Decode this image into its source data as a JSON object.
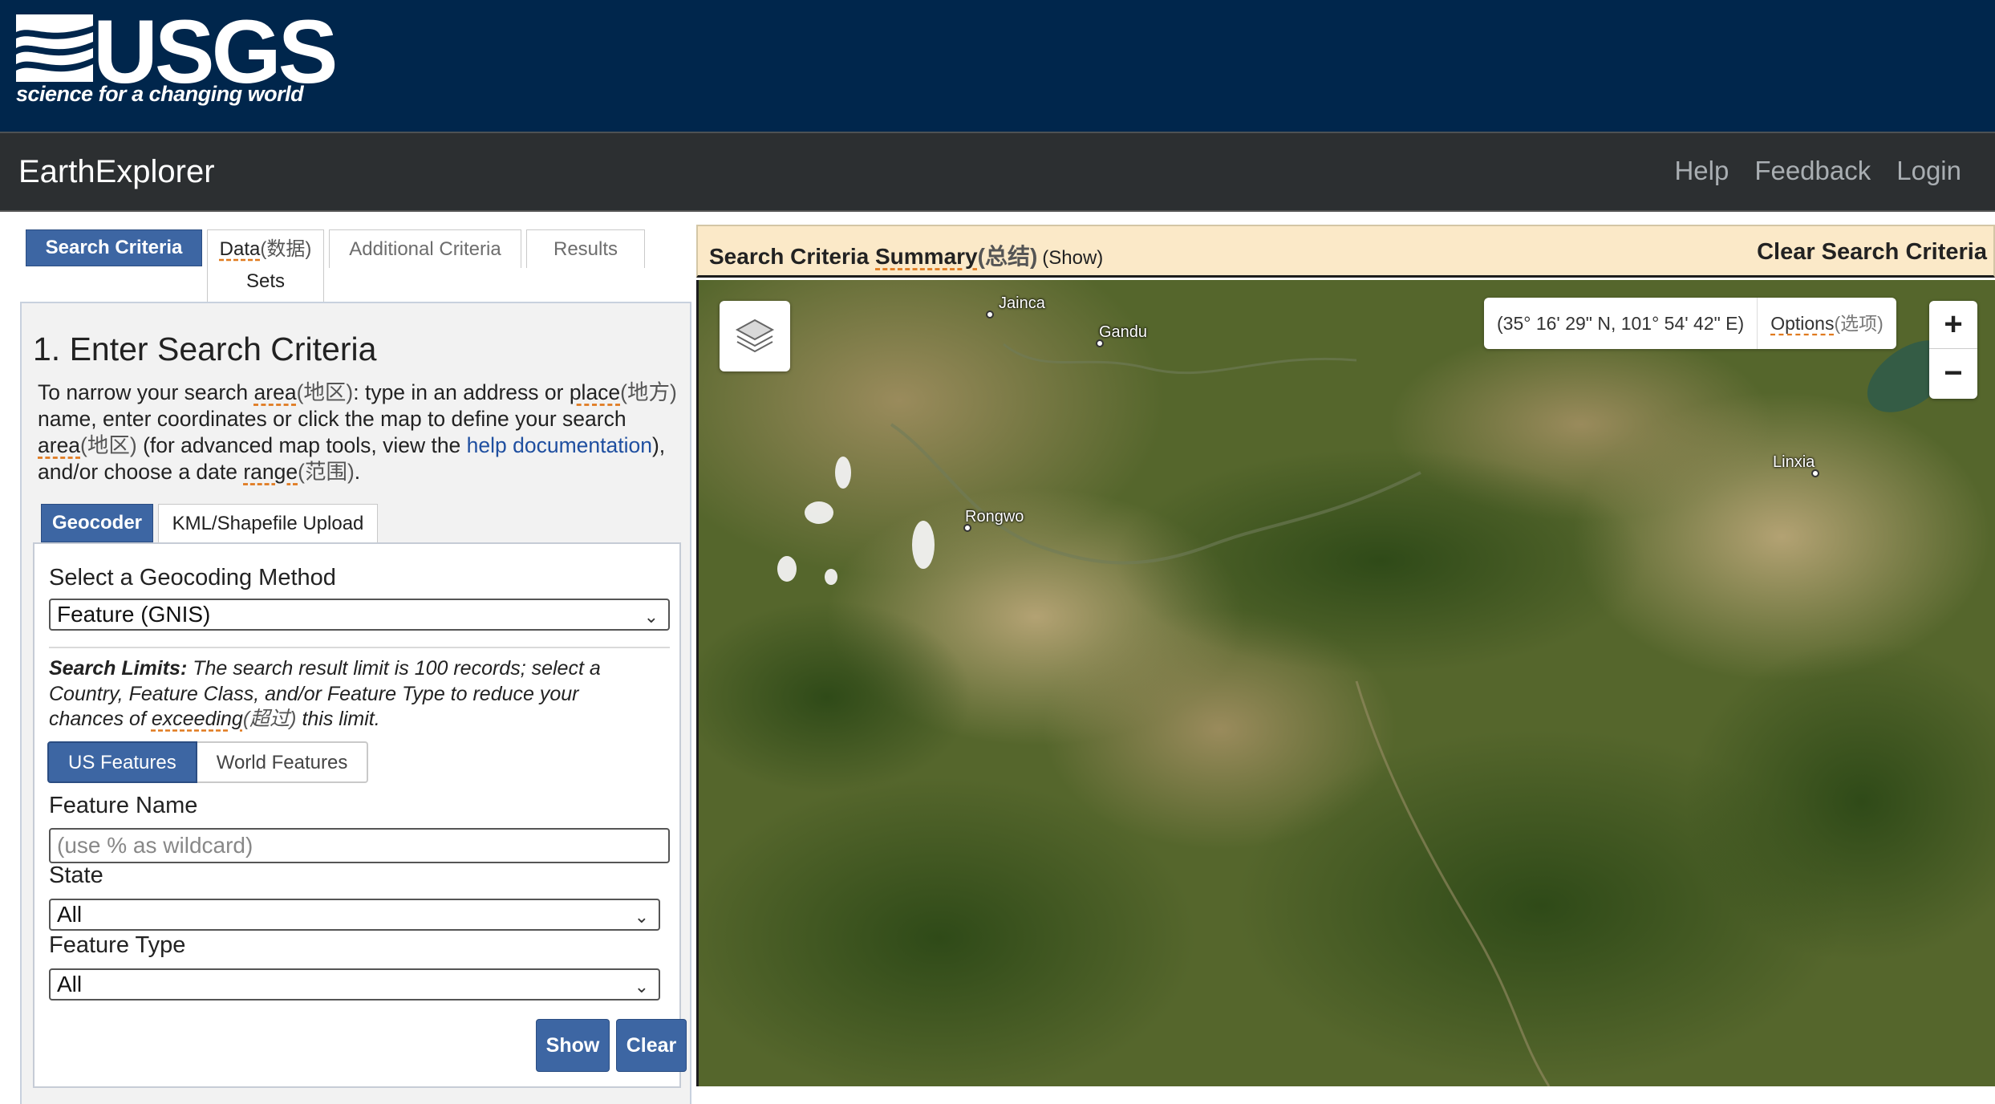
{
  "banner": {
    "logo_word": "USGS",
    "logo_tagline": "science for a changing world",
    "colors": {
      "background": "#00264c",
      "text": "#ffffff"
    }
  },
  "app_bar": {
    "title": "EarthExplorer",
    "nav": [
      "Help",
      "Feedback",
      "Login"
    ]
  },
  "left_tabs": {
    "search_criteria": "Search Criteria",
    "data_sets_line1": "Data",
    "data_sets_cjk": "(数据)",
    "data_sets_line2": "Sets",
    "additional_criteria": "Additional Criteria",
    "results": "Results"
  },
  "step": {
    "title": "1. Enter Search Criteria",
    "intro": {
      "p1": "To narrow your search ",
      "area1": "area",
      "area1_cjk": "(地区)",
      "p2": ": type in an address or ",
      "place": "place",
      "place_cjk": "(地方)",
      "p3": " name, enter coordinates or click the map to define your search ",
      "area2": "area",
      "area2_cjk": "(地区)",
      "p4": " (for advanced map tools, view the ",
      "help_link": "help documentation",
      "p5": "), and/or choose a date ",
      "range": "range",
      "range_cjk": "(范围)",
      "p6": "."
    }
  },
  "geocoder_tabs": {
    "geocoder": "Geocoder",
    "kml": "KML/Shapefile Upload"
  },
  "geocoder": {
    "method_label": "Select a Geocoding Method",
    "method_value": "Feature (GNIS)",
    "limits_bold": "Search Limits:",
    "limits_text1": " The search result limit is 100 records; select a Country, Feature Class, and/or Feature Type to reduce your chances of ",
    "limits_word": "exceeding",
    "limits_cjk": "(超过)",
    "limits_text2": " this limit.",
    "toggle_us": "US Features",
    "toggle_world": "World Features",
    "feature_name_label": "Feature Name",
    "feature_name_value": "",
    "feature_name_placeholder": "(use % as wildcard)",
    "state_label": "State",
    "state_value": "All",
    "feature_type_label": "Feature Type",
    "feature_type_value": "All",
    "show_button": "Show",
    "clear_button": "Clear"
  },
  "summary": {
    "title": "Search Criteria ",
    "title_underlined": "Summary",
    "title_cjk": "(总结)",
    "show": "(Show)",
    "clear": "Clear Search Criteria"
  },
  "map": {
    "coordinates": "(35° 16' 29\" N, 101° 54' 42\" E)",
    "options": "Options",
    "options_cjk": "(选项)",
    "zoom_in": "+",
    "zoom_out": "−",
    "layers_icon": "layers-icon",
    "places": [
      {
        "name": "Jainca"
      },
      {
        "name": "Gandu"
      },
      {
        "name": "Linxia"
      },
      {
        "name": "Rongwo"
      }
    ]
  },
  "colors": {
    "accent": "#3d66a3",
    "app_bar": "#2c2f31",
    "summary_bg": "#fbe9c8",
    "link": "#1f4fa0"
  }
}
